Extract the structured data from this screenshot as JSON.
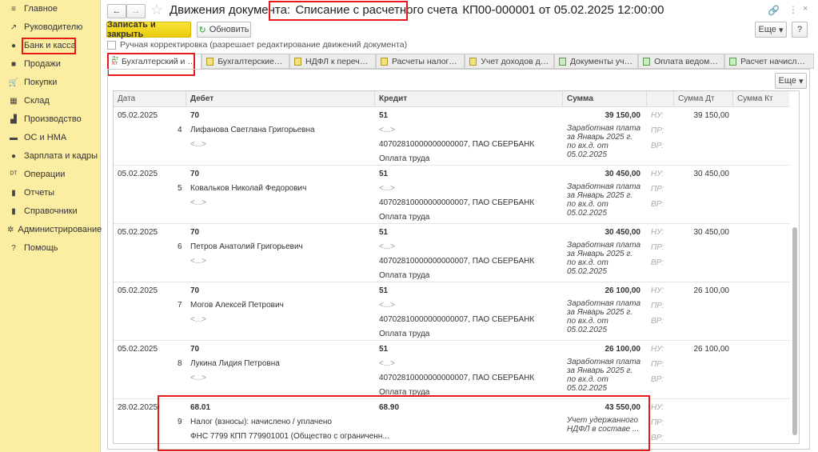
{
  "sidebar": {
    "items": [
      {
        "label": "Главное",
        "icon": "menu-icon"
      },
      {
        "label": "Руководителю",
        "icon": "trend-icon"
      },
      {
        "label": "Банк и касса",
        "icon": "bank-icon"
      },
      {
        "label": "Продажи",
        "icon": "bag-icon"
      },
      {
        "label": "Покупки",
        "icon": "cart-icon"
      },
      {
        "label": "Склад",
        "icon": "warehouse-icon"
      },
      {
        "label": "Производство",
        "icon": "factory-icon"
      },
      {
        "label": "ОС и НМА",
        "icon": "truck-icon"
      },
      {
        "label": "Зарплата и кадры",
        "icon": "person-icon"
      },
      {
        "label": "Операции",
        "icon": "dtkt-icon"
      },
      {
        "label": "Отчеты",
        "icon": "chart-icon"
      },
      {
        "label": "Справочники",
        "icon": "book-icon"
      },
      {
        "label": "Администрирование",
        "icon": "gear-icon"
      },
      {
        "label": "Помощь",
        "icon": "help-icon"
      }
    ]
  },
  "header": {
    "title_prefix": "Движения документа: ",
    "title_doc": "Списание с расчетного счета",
    "title_suffix": " КП00-000001 от 05.02.2025 12:00:00"
  },
  "toolbar": {
    "save_close": "Записать и закрыть",
    "refresh": "Обновить",
    "more": "Еще",
    "help": "?",
    "manual": "Ручная корректировка (разрешает редактирование движений документа)",
    "grid_more": "Еще"
  },
  "tabs": [
    "Бухгалтерский и н...",
    "Бухгалтерские вз...",
    "НДФЛ к перечисл...",
    "Расчеты налогопл...",
    "Учет доходов для...",
    "Документы учтен...",
    "Оплата ведомост...",
    "Расчет начислени..."
  ],
  "columns": {
    "date": "Дата",
    "debit": "Дебет",
    "credit": "Кредит",
    "sum": "Сумма",
    "sum_dt": "Сумма Дт",
    "sum_kt": "Сумма Кт"
  },
  "labels": {
    "nu": "НУ:",
    "pr": "ПР:",
    "vr": "ВР:"
  },
  "records": [
    {
      "date": "05.02.2025",
      "num": "4",
      "debit": "70",
      "debit_sub1": "Лифанова Светлана Григорьевна",
      "debit_sub2": "<...>",
      "credit": "51",
      "credit_sub1": "<...>",
      "credit_sub2": "40702810000000000007, ПАО СБЕРБАНК",
      "credit_sub3": "Оплата труда",
      "sum": "39 150,00",
      "content": "Заработная плата за Январь 2025 г. по вх.д.  от 05.02.2025",
      "sum_dt": "39 150,00"
    },
    {
      "date": "05.02.2025",
      "num": "5",
      "debit": "70",
      "debit_sub1": "Ковальков Николай Федорович",
      "debit_sub2": "<...>",
      "credit": "51",
      "credit_sub1": "<...>",
      "credit_sub2": "40702810000000000007, ПАО СБЕРБАНК",
      "credit_sub3": "Оплата труда",
      "sum": "30 450,00",
      "content": "Заработная плата за Январь 2025 г. по вх.д.  от 05.02.2025",
      "sum_dt": "30 450,00"
    },
    {
      "date": "05.02.2025",
      "num": "6",
      "debit": "70",
      "debit_sub1": "Петров Анатолий Григорьевич",
      "debit_sub2": "<...>",
      "credit": "51",
      "credit_sub1": "<...>",
      "credit_sub2": "40702810000000000007, ПАО СБЕРБАНК",
      "credit_sub3": "Оплата труда",
      "sum": "30 450,00",
      "content": "Заработная плата за Январь 2025 г. по вх.д.  от 05.02.2025",
      "sum_dt": "30 450,00"
    },
    {
      "date": "05.02.2025",
      "num": "7",
      "debit": "70",
      "debit_sub1": "Могов Алексей Петрович",
      "debit_sub2": "<...>",
      "credit": "51",
      "credit_sub1": "<...>",
      "credit_sub2": "40702810000000000007, ПАО СБЕРБАНК",
      "credit_sub3": "Оплата труда",
      "sum": "26 100,00",
      "content": "Заработная плата за Январь 2025 г. по вх.д.  от 05.02.2025",
      "sum_dt": "26 100,00"
    },
    {
      "date": "05.02.2025",
      "num": "8",
      "debit": "70",
      "debit_sub1": "Лукина Лидия Петровна",
      "debit_sub2": "<...>",
      "credit": "51",
      "credit_sub1": "<...>",
      "credit_sub2": "40702810000000000007, ПАО СБЕРБАНК",
      "credit_sub3": "Оплата труда",
      "sum": "26 100,00",
      "content": "Заработная плата за Январь 2025 г. по вх.д.  от 05.02.2025",
      "sum_dt": "26 100,00"
    },
    {
      "date": "28.02.2025",
      "num": "9",
      "debit": "68.01",
      "debit_sub1": "Налог (взносы): начислено / уплачено",
      "debit_sub2": "ФНС 7799 КПП 779901001 (Общество с ограниченн...",
      "credit": "68.90",
      "credit_sub1": "",
      "credit_sub2": "",
      "credit_sub3": "",
      "sum": "43 550,00",
      "content": "Учет удержанного НДФЛ в составе ...",
      "sum_dt": ""
    }
  ]
}
